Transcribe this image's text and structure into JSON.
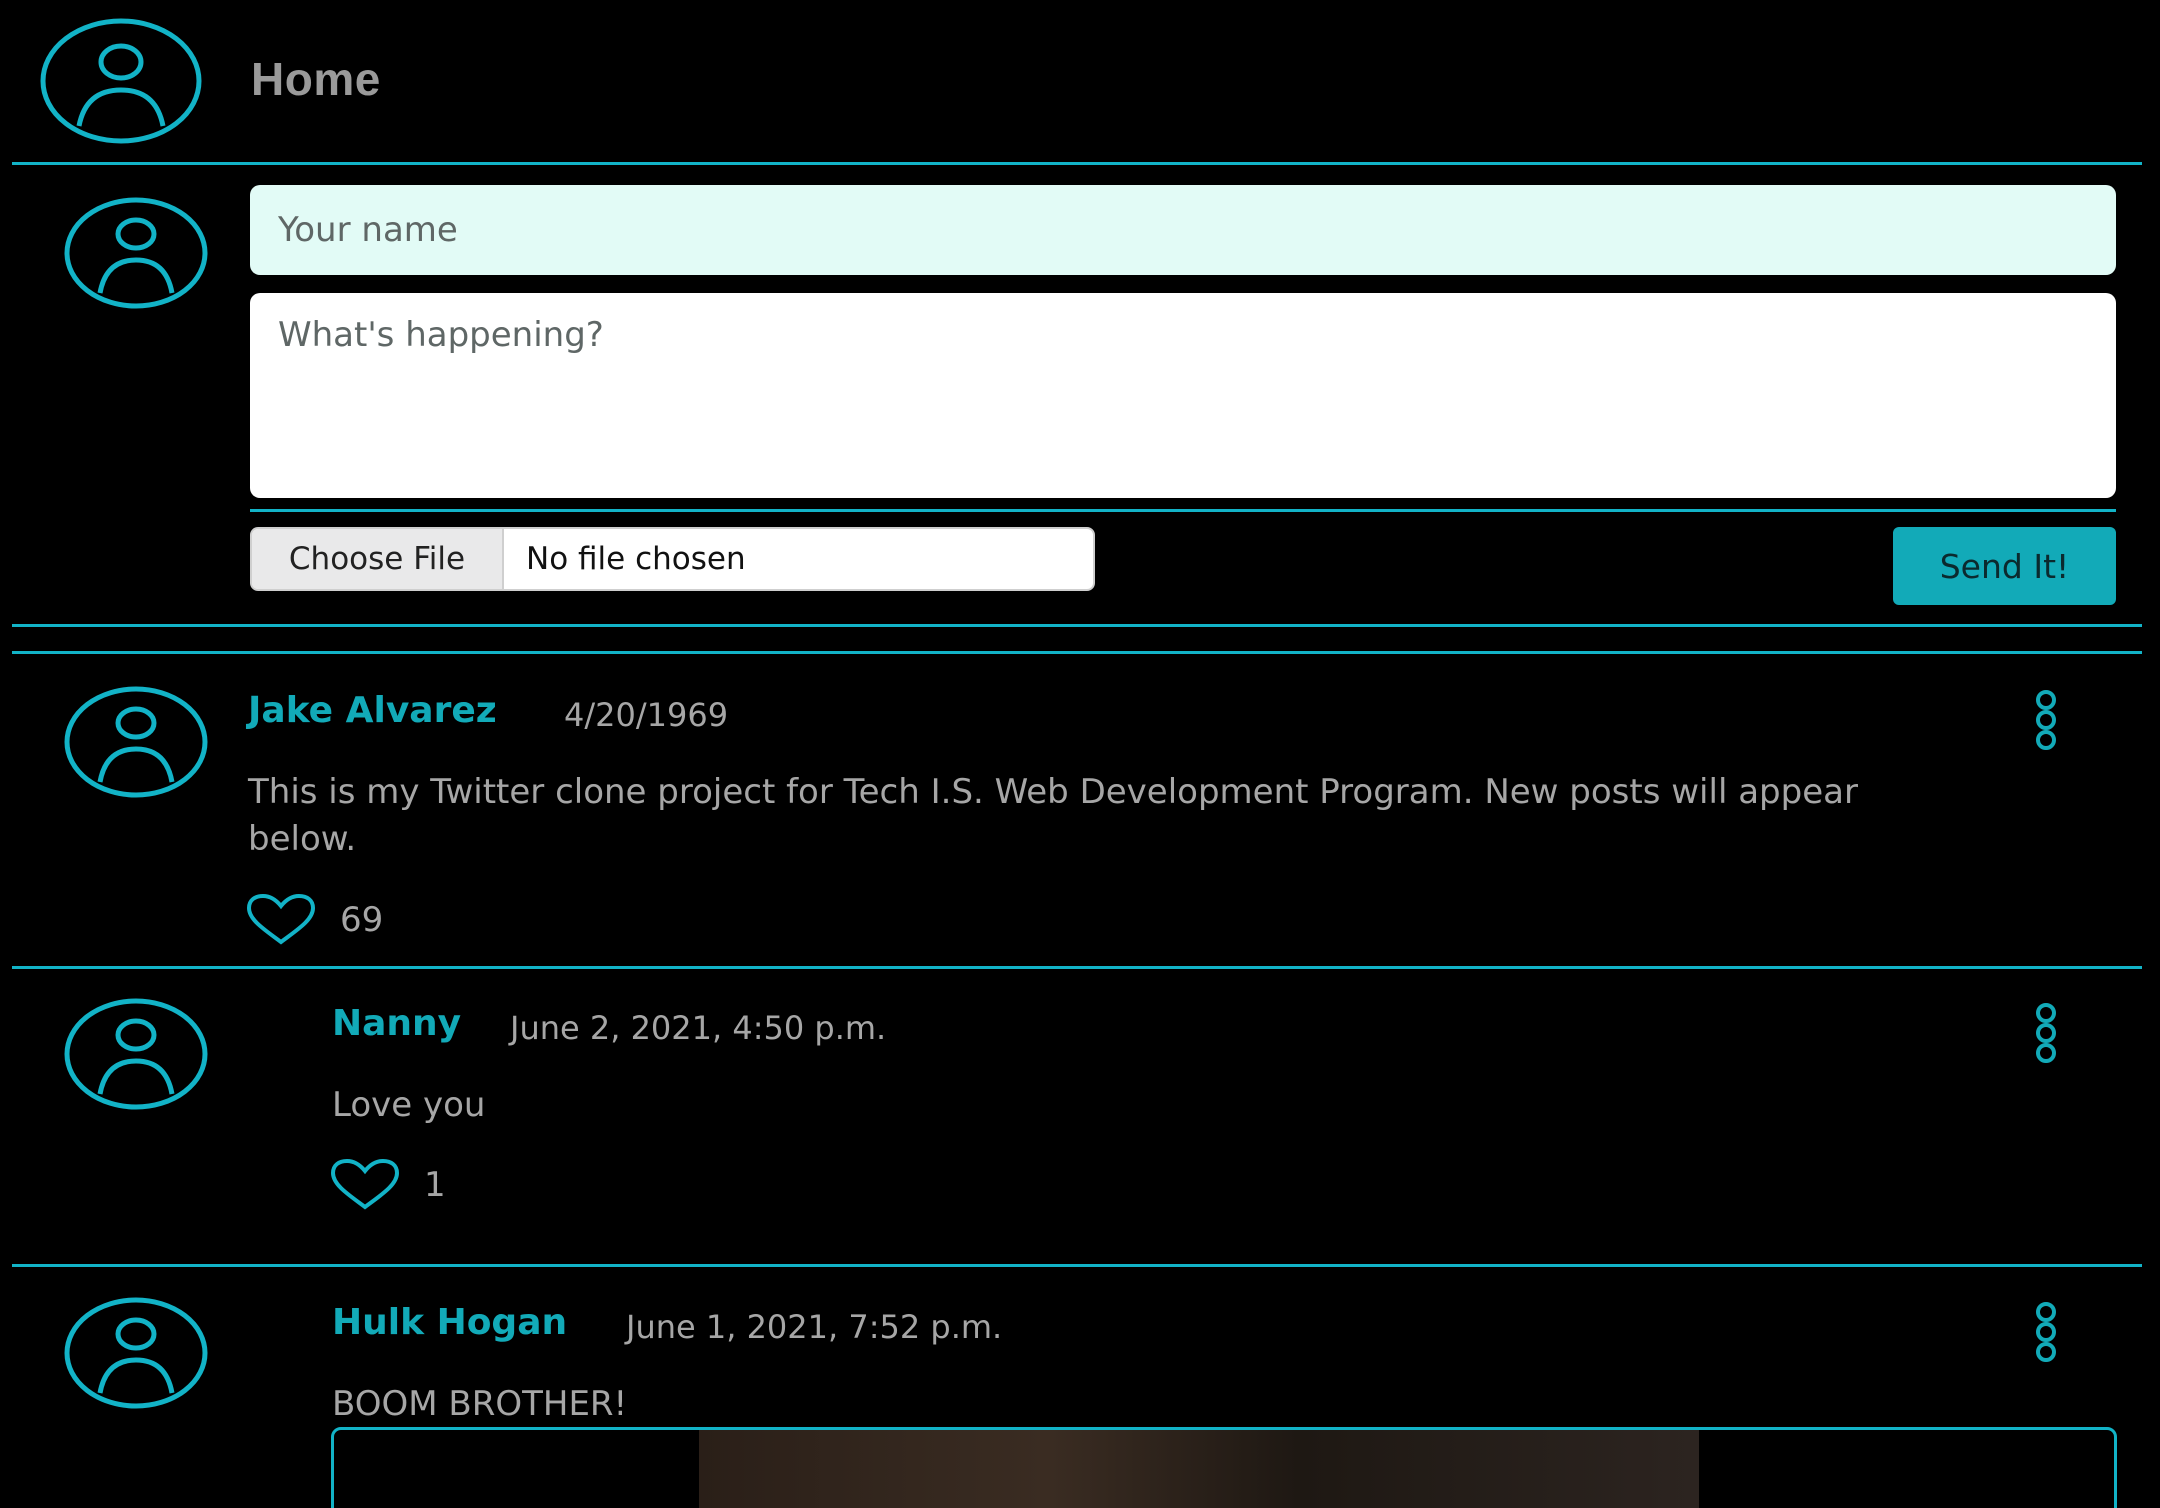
{
  "header": {
    "title": "Home"
  },
  "composer": {
    "name_placeholder": "Your name",
    "text_placeholder": "What's happening?",
    "file_button": "Choose File",
    "file_status": "No file chosen",
    "send_label": "Send It!"
  },
  "posts": [
    {
      "author": "Jake Alvarez",
      "date": "4/20/1969",
      "text_line1": "This is my Twitter clone project for Tech I.S. Web Development Program. New posts will appear",
      "text_line2": "below.",
      "likes": "69"
    },
    {
      "author": "Nanny",
      "date": "June 2, 2021, 4:50 p.m.",
      "text": "Love you",
      "likes": "1"
    },
    {
      "author": "Hulk Hogan",
      "date": "June 1, 2021, 7:52 p.m.",
      "text": "BOOM BROTHER!"
    }
  ],
  "colors": {
    "accent": "#12b3c7",
    "button": "#12aab8",
    "name_field": "#e2fbf6",
    "text": "#a6a6a6"
  },
  "icons": [
    "user-avatar-icon",
    "heart-icon",
    "more-options-icon"
  ]
}
